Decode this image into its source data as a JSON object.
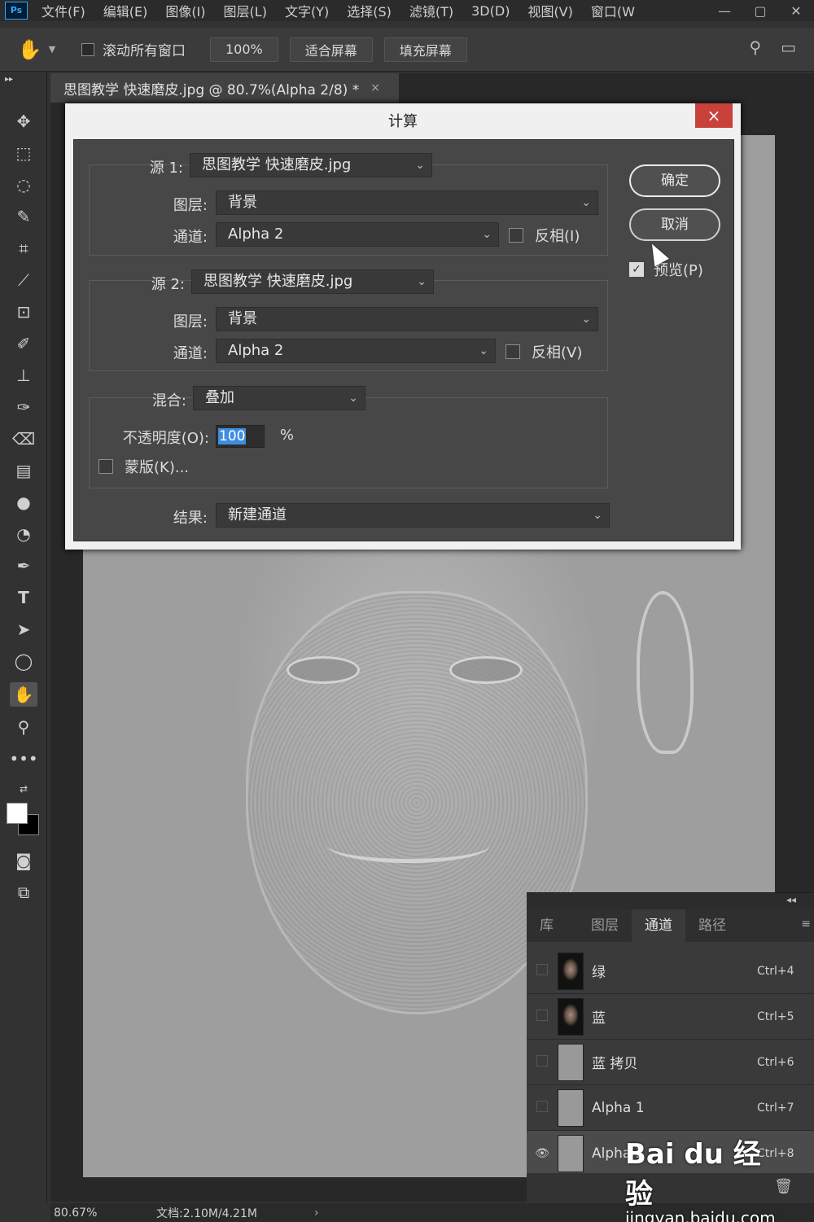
{
  "menu": {
    "items": [
      "文件(F)",
      "编辑(E)",
      "图像(I)",
      "图层(L)",
      "文字(Y)",
      "选择(S)",
      "滤镜(T)",
      "3D(D)",
      "视图(V)",
      "窗口(W"
    ]
  },
  "app_logo": "Ps",
  "options_bar": {
    "scroll_all_label": "滚动所有窗口",
    "zoom_value": "100%",
    "fit_screen": "适合屏幕",
    "fill_screen": "填充屏幕"
  },
  "document_tab": {
    "title": "思图教学 快速磨皮.jpg @ 80.7%(Alpha 2/8) *",
    "close": "×"
  },
  "dialog": {
    "title": "计算",
    "close": "×",
    "source1": {
      "label": "源 1:",
      "value": "思图教学 快速磨皮.jpg",
      "layer_label": "图层:",
      "layer_value": "背景",
      "channel_label": "通道:",
      "channel_value": "Alpha 2",
      "invert_label": "反相(I)"
    },
    "source2": {
      "label": "源 2:",
      "value": "思图教学 快速磨皮.jpg",
      "layer_label": "图层:",
      "layer_value": "背景",
      "channel_label": "通道:",
      "channel_value": "Alpha 2",
      "invert_label": "反相(V)"
    },
    "blend": {
      "label": "混合:",
      "value": "叠加",
      "opacity_label": "不透明度(O):",
      "opacity_value": "100",
      "opacity_unit": "%",
      "mask_label": "蒙版(K)..."
    },
    "result": {
      "label": "结果:",
      "value": "新建通道"
    },
    "ok_button": "确定",
    "cancel_button": "取消",
    "preview_label": "预览(P)",
    "preview_checked": true
  },
  "panel": {
    "tabs": [
      "库",
      "图层",
      "通道",
      "路径"
    ],
    "active_tab": "通道",
    "channels": [
      {
        "name": "绿",
        "shortcut": "Ctrl+4",
        "visible": false,
        "thumb": "face"
      },
      {
        "name": "蓝",
        "shortcut": "Ctrl+5",
        "visible": false,
        "thumb": "face"
      },
      {
        "name": "蓝 拷贝",
        "shortcut": "Ctrl+6",
        "visible": false,
        "thumb": "gray"
      },
      {
        "name": "Alpha 1",
        "shortcut": "Ctrl+7",
        "visible": false,
        "thumb": "gray"
      },
      {
        "name": "Alpha 2",
        "shortcut": "Ctrl+8",
        "visible": true,
        "thumb": "gray"
      }
    ]
  },
  "status": {
    "zoom": "80.67%",
    "doc": "文档:2.10M/4.21M",
    "arrow": "›"
  },
  "watermark": {
    "logo": "Bai du 经验",
    "url": "jingyan.baidu.com"
  }
}
